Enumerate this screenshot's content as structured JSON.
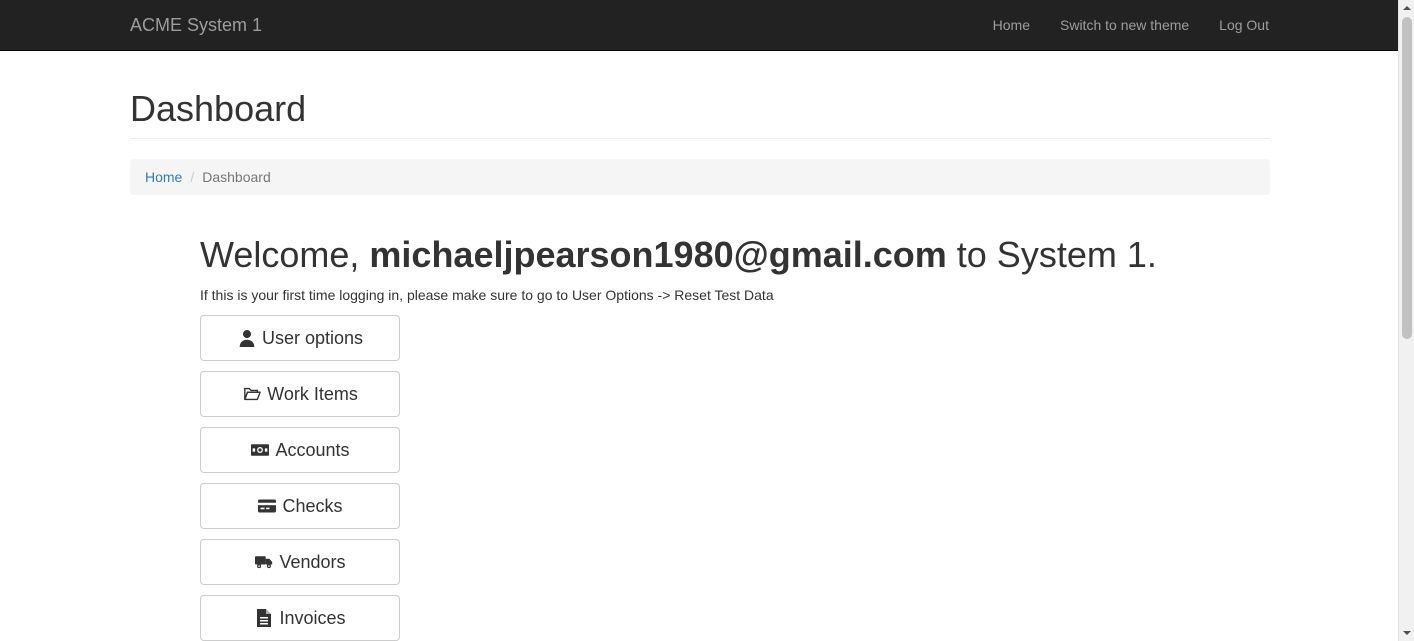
{
  "navbar": {
    "brand": "ACME System 1",
    "links": [
      "Home",
      "Switch to new theme",
      "Log Out"
    ]
  },
  "page": {
    "title": "Dashboard"
  },
  "breadcrumb": {
    "home": "Home",
    "separator": "/",
    "current": "Dashboard"
  },
  "welcome": {
    "prefix": "Welcome,",
    "user": "michaeljpearson1980@gmail.com",
    "suffix": "to System 1.",
    "note": "If this is your first time logging in, please make sure to go to User Options -> Reset Test Data"
  },
  "menu": {
    "items": [
      {
        "label": "User options",
        "icon": "user-icon"
      },
      {
        "label": "Work Items",
        "icon": "folder-open-icon"
      },
      {
        "label": "Accounts",
        "icon": "money-icon"
      },
      {
        "label": "Checks",
        "icon": "credit-card-icon"
      },
      {
        "label": "Vendors",
        "icon": "truck-icon"
      },
      {
        "label": "Invoices",
        "icon": "file-text-icon"
      }
    ]
  },
  "colors": {
    "navbar_bg": "#222222",
    "nav_text": "#9d9d9d",
    "link": "#337ab7",
    "breadcrumb_bg": "#f5f5f5",
    "button_border": "#cccccc",
    "text": "#333333"
  }
}
